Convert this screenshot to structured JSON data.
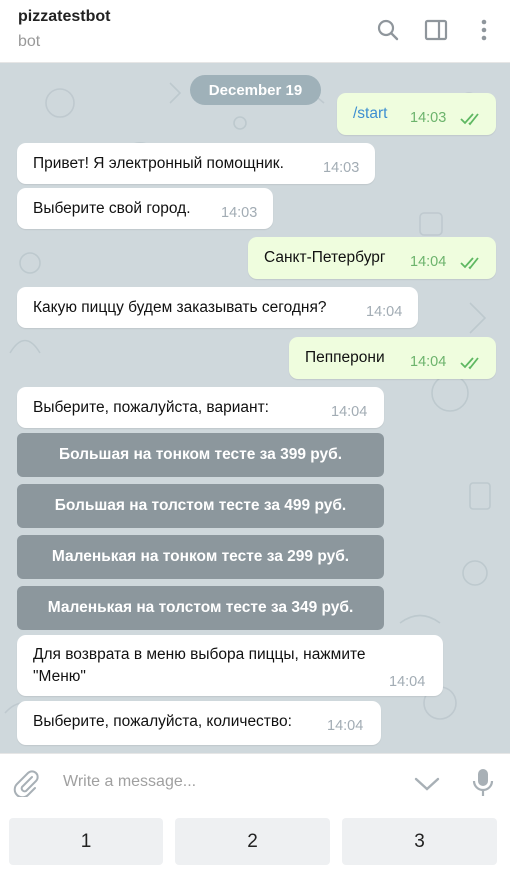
{
  "header": {
    "title": "pizzatestbot",
    "subtitle": "bot"
  },
  "chat": {
    "date": "December 19",
    "messages": [
      {
        "text": "/start",
        "time": "14:03"
      },
      {
        "text": "Привет! Я электронный помощник.",
        "time": "14:03"
      },
      {
        "text": "Выберите свой город.",
        "time": "14:03"
      },
      {
        "text": "Санкт-Петербург",
        "time": "14:04"
      },
      {
        "text": "Какую пиццу будем заказывать сегодня?",
        "time": "14:04"
      },
      {
        "text": "Пепперони",
        "time": "14:04"
      },
      {
        "text": "Выберите, пожалуйста, вариант:",
        "time": "14:04"
      },
      {
        "line1": "Для возврата в меню выбора пиццы, нажмите",
        "line2": "\"Меню\"",
        "time": "14:04"
      },
      {
        "text": "Выберите, пожалуйста, количество:",
        "time": "14:04"
      }
    ],
    "inline_buttons": [
      "Большая на тонком тесте за 399 руб.",
      "Большая на толстом тесте за 499 руб.",
      "Маленькая на тонком тесте за 299 руб.",
      "Маленькая на толстом тесте за 349 руб."
    ]
  },
  "input": {
    "placeholder": "Write a message..."
  },
  "reply_keyboard": [
    "1",
    "2",
    "3"
  ],
  "colors": {
    "chat_bg": "#cfd8dc",
    "outgoing": "#effdde",
    "incoming": "#ffffff",
    "accent": "#3d8fd1",
    "check": "#6cb36c"
  },
  "icons": [
    "search-icon",
    "sidebar-toggle-icon",
    "more-vertical-icon",
    "double-check-icon",
    "paperclip-icon",
    "chevron-down-icon",
    "microphone-icon"
  ]
}
